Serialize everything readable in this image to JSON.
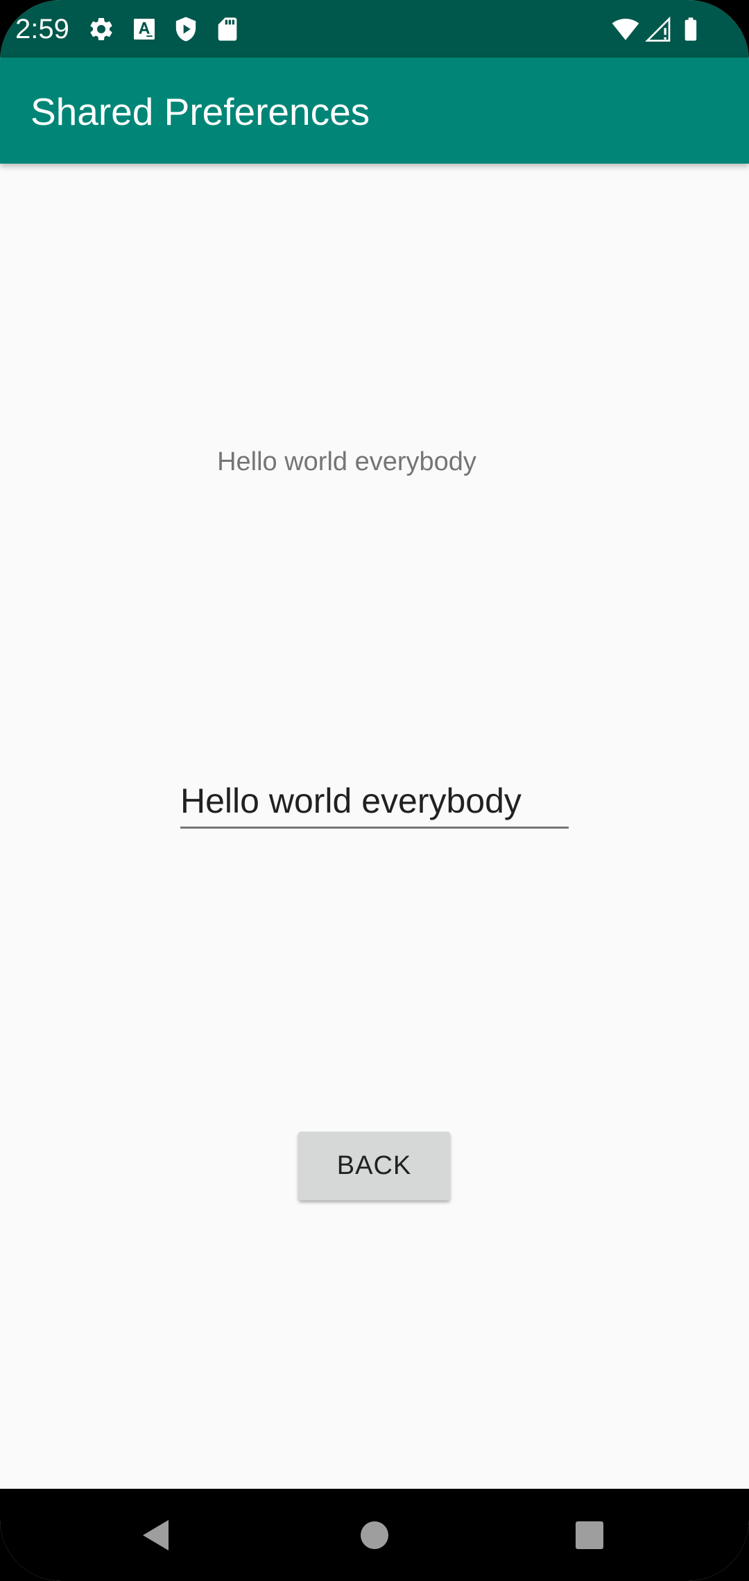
{
  "status_bar": {
    "time": "2:59",
    "left_icons": [
      "gear-icon",
      "font-a-icon",
      "shield-play-icon",
      "sd-card-icon"
    ],
    "right_icons": [
      "wifi-icon",
      "signal-icon",
      "battery-icon"
    ],
    "background_color": "#00574b"
  },
  "app_bar": {
    "title": "Shared Preferences",
    "background_color": "#008577"
  },
  "main": {
    "saved_text": "Hello world everybody",
    "input_value": "Hello world everybody",
    "back_button_label": "BACK"
  },
  "nav_bar": {
    "buttons": [
      "back-triangle-icon",
      "home-circle-icon",
      "recents-square-icon"
    ]
  }
}
